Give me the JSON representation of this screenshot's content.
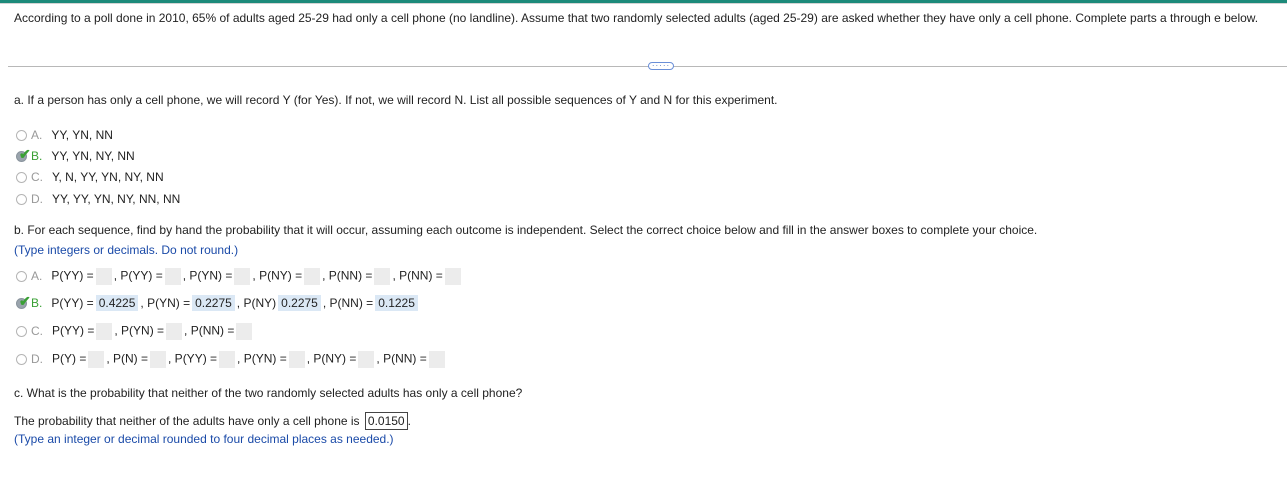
{
  "intro": "According to a poll done in 2010, 65% of adults aged 25-29 had only a cell phone (no landline). Assume that two randomly selected adults (aged 25-29) are asked whether they have only a cell phone. Complete parts a through e below.",
  "separator_icon": "ellipsis-icon",
  "separator_glyph": "·····",
  "part_a": {
    "question": "a. If a person has only a cell phone, we will record Y (for Yes). If not, we will record N. List all possible sequences of Y and N for this experiment.",
    "options": [
      {
        "letter": "A.",
        "text": "YY, YN, NN"
      },
      {
        "letter": "B.",
        "text": "YY, YN, NY, NN"
      },
      {
        "letter": "C.",
        "text": "Y, N, YY, YN, NY, NN"
      },
      {
        "letter": "D.",
        "text": "YY, YY, YN, NY, NN, NN"
      }
    ],
    "selected": "B"
  },
  "part_b": {
    "question": "b. For each sequence, find by hand the probability that it will occur, assuming each outcome is independent. Select the correct choice below and fill in the answer boxes to complete your choice.",
    "hint": "(Type integers or decimals. Do not round.)",
    "selected": "B",
    "option_a": {
      "letter": "A.",
      "l1": "P(YY) =",
      "l2": ", P(YY) =",
      "l3": ", P(YN) =",
      "l4": ", P(NY) =",
      "l5": ",  P(NN) =",
      "l6": ", P(NN) ="
    },
    "option_b": {
      "letter": "B.",
      "l1": "P(YY) =",
      "v1": "0.4225",
      "l2": ", P(YN) =",
      "v2": "0.2275",
      "l3": ", P(NY)",
      "v3": "0.2275",
      "l4": ", P(NN) =",
      "v4": "0.1225"
    },
    "option_c": {
      "letter": "C.",
      "l1": "P(YY) =",
      "l2": ", P(YN) =",
      "l3": ",  P(NN) ="
    },
    "option_d": {
      "letter": "D.",
      "l1": "P(Y) =",
      "l2": ", P(N) =",
      "l3": ", P(YY) =",
      "l4": ", P(YN) =",
      "l5": ", P(NY) =",
      "l6": ", P(NN) ="
    }
  },
  "part_c": {
    "question": "c. What is the probability that neither of the two randomly selected adults has only a cell phone?",
    "answer_prefix": "The probability that neither of the adults have only a cell phone is",
    "answer_value": "0.0150",
    "answer_suffix": ".",
    "hint": "(Type an integer or decimal rounded to four decimal places as needed.)"
  },
  "colors": {
    "accent": "#1d8a7a",
    "hint": "#1a4aa8",
    "correct": "#3aa035",
    "filled_bg": "#dbe8f5",
    "blank_bg": "#ececec"
  }
}
